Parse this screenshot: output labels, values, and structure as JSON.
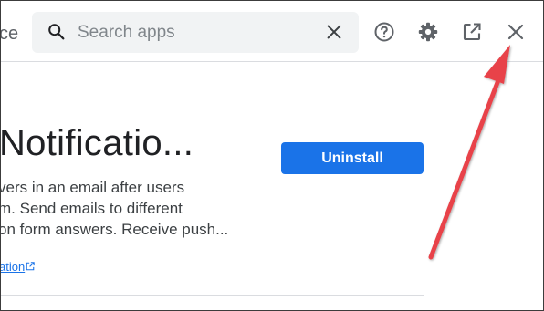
{
  "header": {
    "partial_left_text": "ce",
    "search": {
      "placeholder": "Search apps"
    },
    "buttons": {
      "clear": "close-icon",
      "help": "help-icon",
      "settings": "gear-icon",
      "open_new": "open-in-new-icon",
      "close": "close-icon"
    }
  },
  "app": {
    "title": "Notificatio...",
    "description_lines": [
      "vers in an email after users",
      "m. Send emails to different",
      "on form answers. Receive push..."
    ],
    "link_text": "ation",
    "uninstall_label": "Uninstall"
  },
  "colors": {
    "accent": "#1a73e8",
    "annotation_arrow": "#e8434a",
    "search_bg": "#f1f3f4",
    "icon": "#5f6368"
  }
}
